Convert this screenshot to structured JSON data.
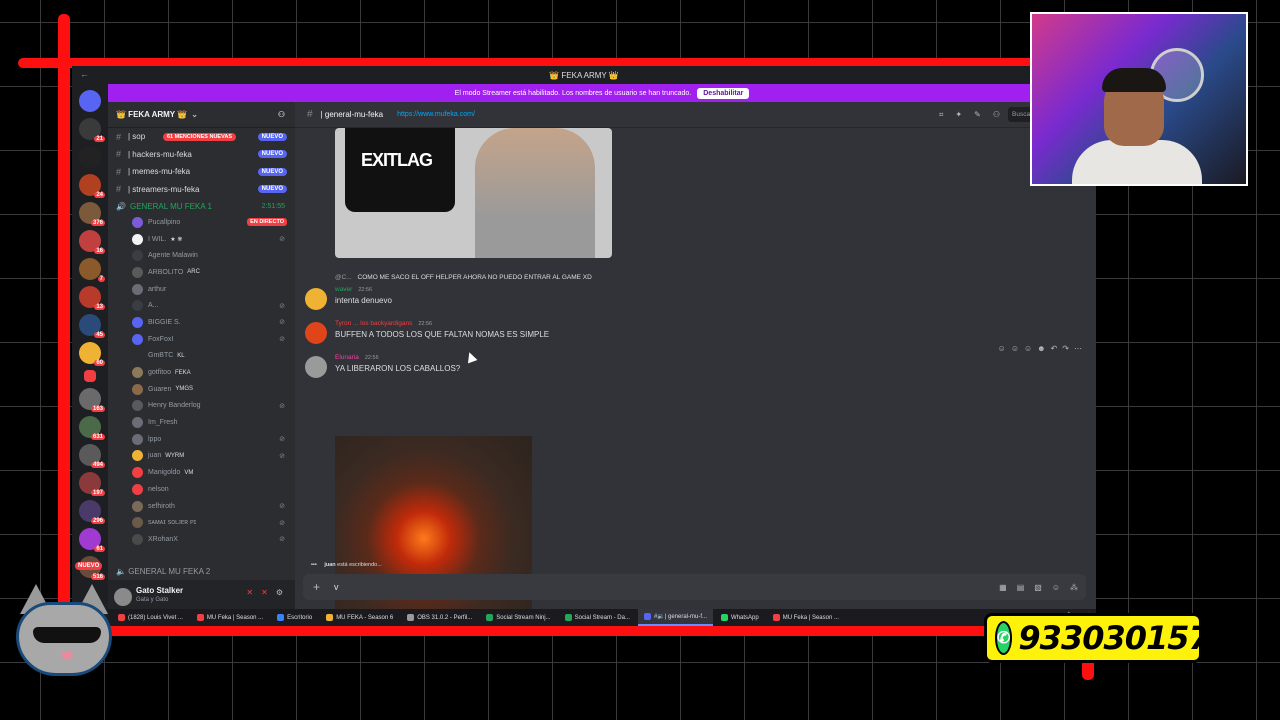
{
  "titlebar": {
    "title": "👑 FEKA ARMY 👑",
    "left_icon": "arrow-left-icon",
    "right_icons": [
      "inbox-icon",
      "screen-icon",
      "help-icon"
    ]
  },
  "banner": {
    "text": "El modo Streamer está habilitado. Los nombres de usuario se han truncado.",
    "button": "Deshabilitar"
  },
  "server_rail": {
    "badges": [
      "21",
      "24",
      "24",
      "376",
      "16",
      "7",
      "13",
      "45",
      "60",
      "163",
      "631",
      "494",
      "197",
      "296",
      "61",
      "516"
    ],
    "nuevo": "NUEVO"
  },
  "sidebar": {
    "guild_name": "👑 FEKA ARMY 👑",
    "mentions_badge": "61 MENCIONES NUEVAS",
    "channels": [
      {
        "label": "| sop",
        "nuevo": "NUEVO"
      },
      {
        "label": "| hackers-mu-feka",
        "nuevo": "NUEVO"
      },
      {
        "label": "| memes-mu-feka",
        "nuevo": "NUEVO"
      },
      {
        "label": "| streamers-mu-feka",
        "nuevo": "NUEVO"
      }
    ],
    "voice_channel": {
      "label": "GENERAL MU FEKA 1",
      "timer": "2:51:55"
    },
    "live_badge": "EN DIRECTO",
    "voice_users": [
      {
        "name": "Pucallpino",
        "tag": "",
        "color": "#7b5bd6"
      },
      {
        "name": "I WIL.",
        "tag": "★ ❋",
        "color": "#f2f3f5"
      },
      {
        "name": "Agente Malawin",
        "tag": "",
        "color": "#3b3d44"
      },
      {
        "name": "ARBOLITO",
        "tag": "ARC",
        "color": "#5a5a5a"
      },
      {
        "name": "arthur",
        "tag": "",
        "color": "#6a6d75"
      },
      {
        "name": "A...",
        "tag": "",
        "color": "#3b3d44"
      },
      {
        "name": "BIGGIE S.",
        "tag": "",
        "color": "#5865f2"
      },
      {
        "name": "FoxFoxI",
        "tag": "",
        "color": "#5865f2"
      },
      {
        "name": "GmBTC",
        "tag": "KL",
        "color": "#2b2d31"
      },
      {
        "name": "gotfitoo",
        "tag": "FEKA",
        "color": "#8a7a5a"
      },
      {
        "name": "Guaren",
        "tag": "YMGS",
        "color": "#8a6a4a"
      },
      {
        "name": "Henry Banderlog",
        "tag": "",
        "color": "#5a5a5a"
      },
      {
        "name": "Im_Fresh",
        "tag": "",
        "color": "#6a6d75"
      },
      {
        "name": "lppo",
        "tag": "",
        "color": "#6a6d75"
      },
      {
        "name": "juan",
        "tag": "WYRM",
        "color": "#f0b232"
      },
      {
        "name": "Manigoldo",
        "tag": "VM",
        "color": "#f23f43"
      },
      {
        "name": "nelson",
        "tag": "",
        "color": "#f23f43"
      },
      {
        "name": "sefhiroth",
        "tag": "",
        "color": "#7a6a5a"
      },
      {
        "name": "sᴀᴍᴀɪ sᴏʟᴊᴇʀ ᴘɪ",
        "tag": "",
        "color": "#6a5a4a"
      },
      {
        "name": "XRohanX",
        "tag": "",
        "color": "#4a4a4a"
      }
    ],
    "voice_channel_2": "GENERAL MU FEKA 2"
  },
  "user_panel": {
    "name": "Gato Stalker",
    "subtitle": "Gata y Gato"
  },
  "channel_header": {
    "name": "| general-mu-feka",
    "topic": "https://www.mufeka.com/",
    "search_placeholder": "Buscar 👑 FEKA ARMY"
  },
  "messages": {
    "image_logo_text": "EXITLAG",
    "reply_preview": {
      "name": "@C...",
      "text": "COMO ME SACO EL OFF HELPER AHORA NO PUEDO ENTRAR AL GAME XD"
    },
    "items": [
      {
        "author": "waver",
        "time": "22:56",
        "text": "intenta denuevo",
        "color": "#23a55a",
        "avatar": "#f0b232"
      },
      {
        "author": "Tyron ... los backyardigans",
        "time": "22:56",
        "text": "BUFFEN A TODOS LOS QUE FALTAN NOMAS ES SIMPLE",
        "color": "#f23f43",
        "avatar": "#e0451a"
      },
      {
        "author": "Elunaria",
        "time": "22:56",
        "text": "YA LIBERARON LOS CABALLOS?",
        "color": "#eb459e",
        "avatar": "#9a9a9a"
      }
    ]
  },
  "typing": {
    "user": "juan",
    "text": "está escribiendo..."
  },
  "composer": {
    "value": "v"
  },
  "taskbar": {
    "items": [
      {
        "label": "(1828) Louis Vivet ...",
        "color": "#f23f43"
      },
      {
        "label": "MU Feka | Season ...",
        "color": "#f23f43"
      },
      {
        "label": "Escritorio",
        "color": "#3b82f6"
      },
      {
        "label": "MU FEKA - Season 6",
        "color": "#f0b232"
      },
      {
        "label": "OBS 31.0.2 - Perfil...",
        "color": "#9a9a9a"
      },
      {
        "label": "Social Stream Ninj...",
        "color": "#23a55a"
      },
      {
        "label": "Social Stream - Da...",
        "color": "#23a55a"
      },
      {
        "label": "#🔉| general-mu-f...",
        "color": "#5865f2"
      },
      {
        "label": "WhatsApp",
        "color": "#25d366"
      },
      {
        "label": "MU Feka | Season ...",
        "color": "#f23f43"
      }
    ]
  },
  "overlay": {
    "phone": "933030157"
  },
  "colors": {
    "accent": "#5865f2",
    "banner": "#a020f0",
    "frame": "#ff1010",
    "whatsapp_box": "#fff20a"
  }
}
